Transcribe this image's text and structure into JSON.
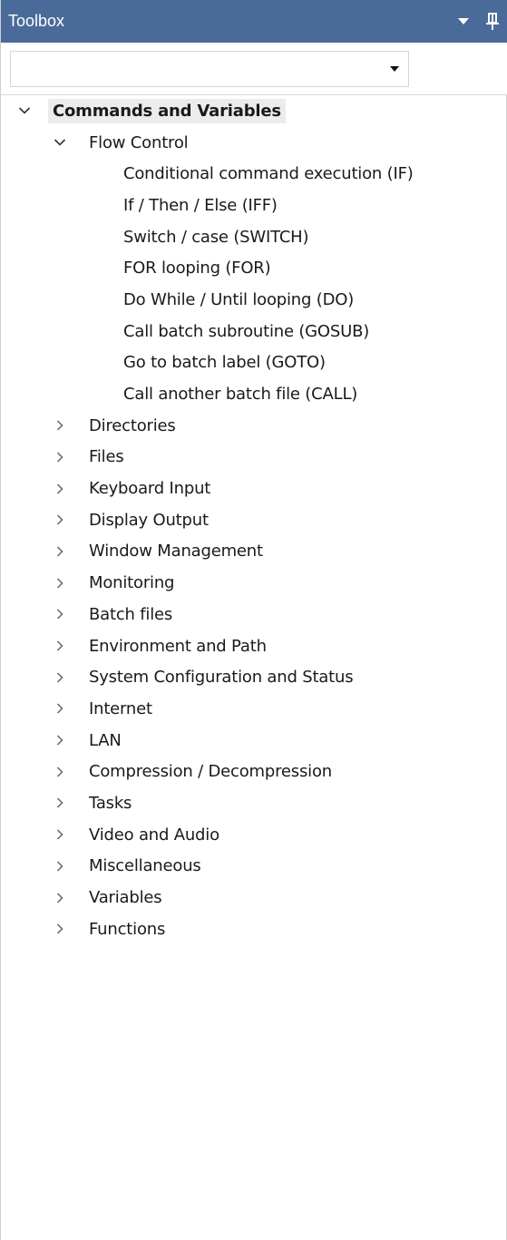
{
  "window": {
    "title": "Toolbox",
    "controls": [
      {
        "name": "dropdown-arrow-icon"
      },
      {
        "name": "pin-icon"
      }
    ]
  },
  "combo": {
    "value": "",
    "arrow_icon": "dropdown-arrow-icon"
  },
  "tree": {
    "root": {
      "label": "Commands and Variables",
      "expanded": true,
      "toggle_icon": "chevron-down-icon"
    },
    "flow_control": {
      "label": "Flow Control",
      "expanded": true,
      "toggle_icon": "chevron-down-icon",
      "items": [
        "Conditional command execution (IF)",
        "If / Then / Else (IFF)",
        "Switch / case (SWITCH)",
        "FOR looping (FOR)",
        "Do While / Until looping (DO)",
        "Call batch subroutine (GOSUB)",
        "Go to batch label (GOTO)",
        "Call another batch file (CALL)"
      ]
    },
    "categories": [
      "Directories",
      "Files",
      "Keyboard Input",
      "Display Output",
      "Window Management",
      "Monitoring",
      "Batch files",
      "Environment and Path",
      "System Configuration and Status",
      "Internet",
      "LAN",
      "Compression / Decompression",
      "Tasks",
      "Video and Audio",
      "Miscellaneous",
      "Variables",
      "Functions"
    ]
  },
  "colors": {
    "titlebar_bg": "#4a6b99",
    "titlebar_fg": "#ffffff",
    "root_highlight": "#ececec",
    "text": "#1a1a1a",
    "chevron": "#555555"
  }
}
